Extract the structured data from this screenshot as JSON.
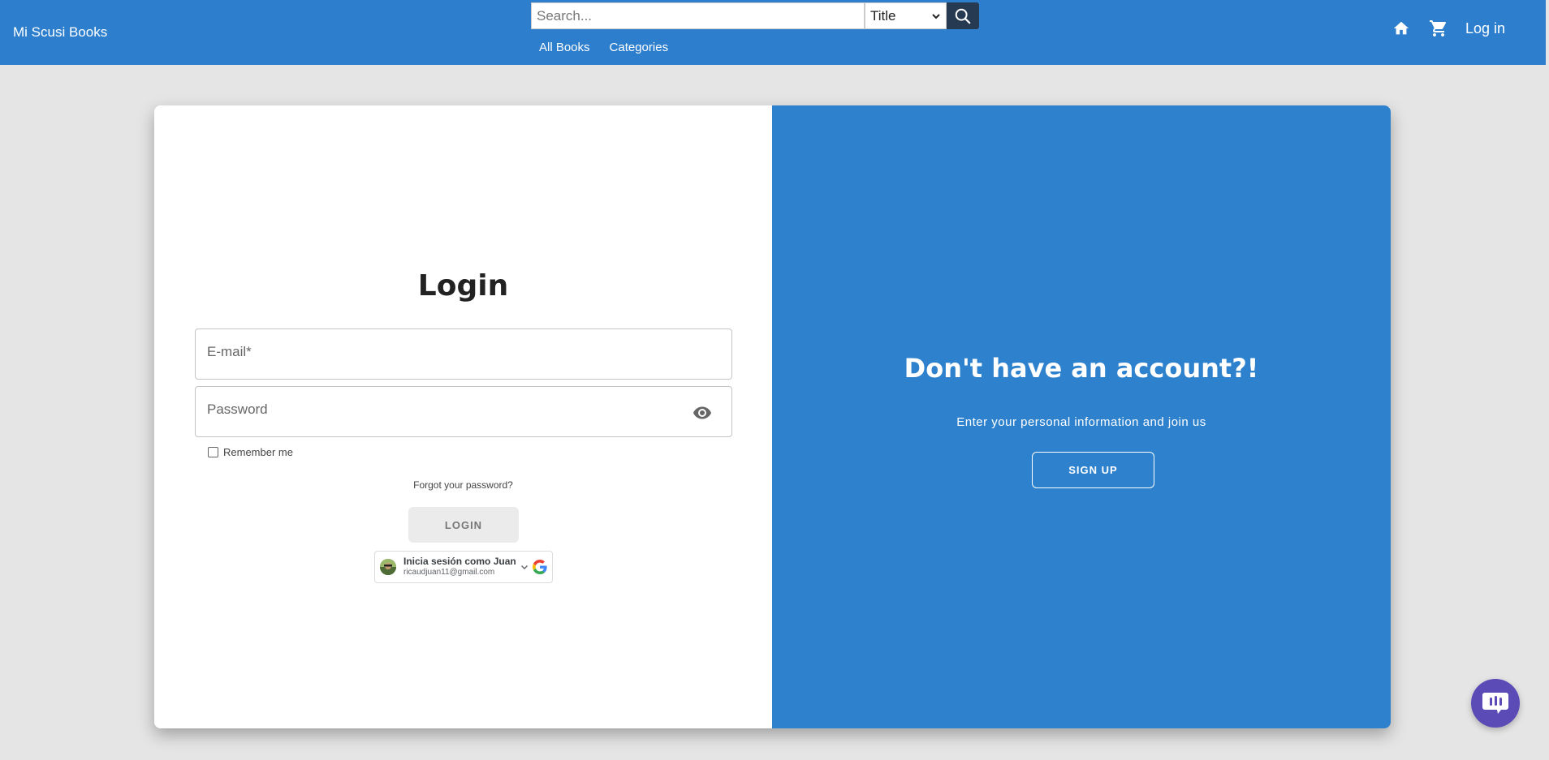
{
  "header": {
    "brand": "Mi Scusi Books",
    "search": {
      "placeholder": "Search...",
      "filter_value": "Title"
    },
    "nav": {
      "all_books": "All Books",
      "categories": "Categories"
    },
    "login_label": "Log in",
    "icons": {
      "search": "search-icon",
      "home": "home-icon",
      "cart": "cart-icon"
    }
  },
  "login": {
    "title": "Login",
    "email_placeholder": "E-mail*",
    "password_placeholder": "Password",
    "remember_label": "Remember me",
    "forgot_label": "Forgot your password?",
    "login_button": "LOGIN",
    "google": {
      "name": "Inicia sesión como Juan",
      "email": "ricaudjuan11@gmail.com"
    }
  },
  "signup": {
    "title": "Don't have an account?!",
    "subtitle": "Enter your personal information and join us",
    "button": "SIGN UP"
  },
  "colors": {
    "primary": "#2d7fcd",
    "search_button": "#263a52",
    "chat_button": "#5a4bb7"
  }
}
